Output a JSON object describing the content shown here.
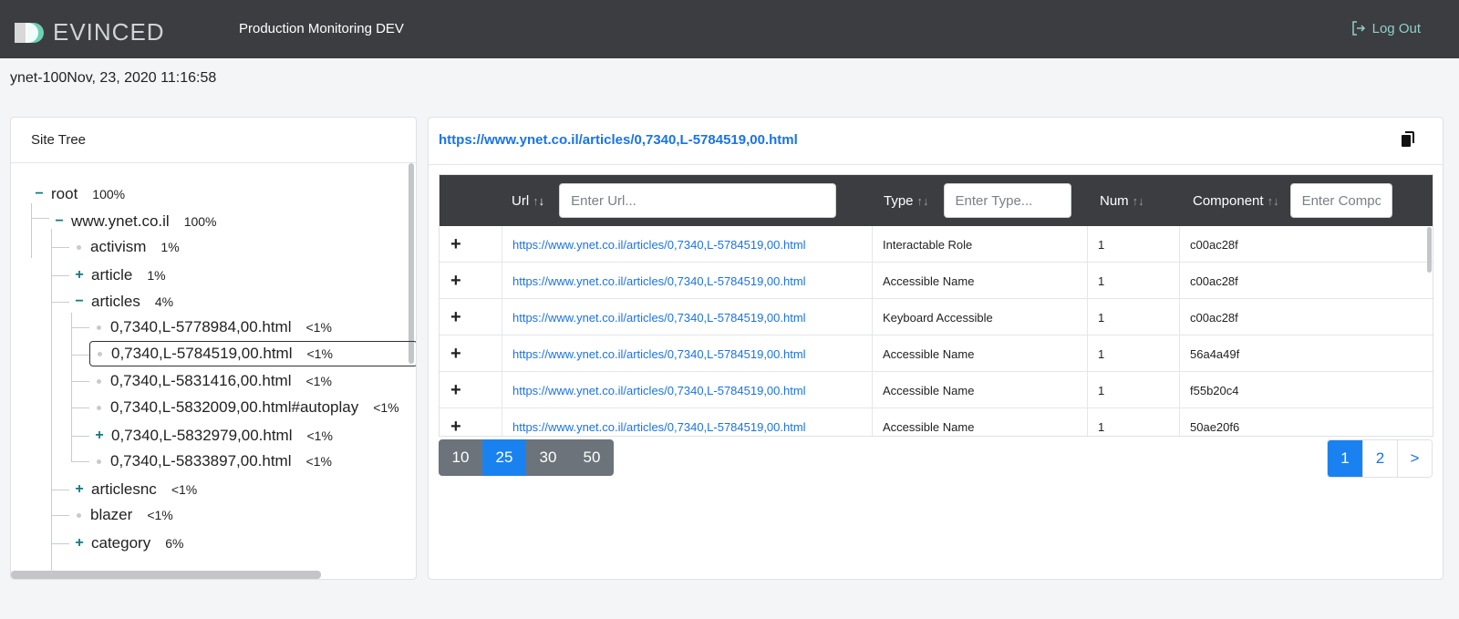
{
  "header": {
    "logo_text": "EVINCED",
    "app_title": "Production Monitoring DEV",
    "logout_label": "Log Out"
  },
  "run": {
    "label": "ynet-100Nov, 23, 2020 11:16:58"
  },
  "site_tree": {
    "title": "Site Tree",
    "nodes": [
      {
        "label": "root",
        "pct": "100%",
        "toggle": "−"
      },
      {
        "label": "www.ynet.co.il",
        "pct": "100%",
        "toggle": "−"
      },
      {
        "label": "activism",
        "pct": "1%",
        "toggle": ""
      },
      {
        "label": "article",
        "pct": "1%",
        "toggle": "+"
      },
      {
        "label": "articles",
        "pct": "4%",
        "toggle": "−"
      },
      {
        "label": "0,7340,L-5778984,00.html",
        "pct": "<1%",
        "toggle": ""
      },
      {
        "label": "0,7340,L-5784519,00.html",
        "pct": "<1%",
        "toggle": ""
      },
      {
        "label": "0,7340,L-5831416,00.html",
        "pct": "<1%",
        "toggle": ""
      },
      {
        "label": "0,7340,L-5832009,00.html#autoplay",
        "pct": "<1%",
        "toggle": ""
      },
      {
        "label": "0,7340,L-5832979,00.html",
        "pct": "<1%",
        "toggle": "+"
      },
      {
        "label": "0,7340,L-5833897,00.html",
        "pct": "<1%",
        "toggle": ""
      },
      {
        "label": "articlesnc",
        "pct": "<1%",
        "toggle": "+"
      },
      {
        "label": "blazer",
        "pct": "<1%",
        "toggle": ""
      },
      {
        "label": "category",
        "pct": "6%",
        "toggle": "+"
      }
    ]
  },
  "detail": {
    "url": "https://www.ynet.co.il/articles/0,7340,L-5784519,00.html",
    "columns": {
      "url": {
        "label": "Url",
        "placeholder": "Enter Url..."
      },
      "type": {
        "label": "Type",
        "placeholder": "Enter Type..."
      },
      "num": {
        "label": "Num"
      },
      "component": {
        "label": "Component",
        "placeholder": "Enter Component..."
      }
    },
    "rows": [
      {
        "expand": "+",
        "url": "https://www.ynet.co.il/articles/0,7340,L-5784519,00.html",
        "type": "Interactable Role",
        "num": "1",
        "component": "c00ac28f"
      },
      {
        "expand": "+",
        "url": "https://www.ynet.co.il/articles/0,7340,L-5784519,00.html",
        "type": "Accessible Name",
        "num": "1",
        "component": "c00ac28f"
      },
      {
        "expand": "+",
        "url": "https://www.ynet.co.il/articles/0,7340,L-5784519,00.html",
        "type": "Keyboard Accessible",
        "num": "1",
        "component": "c00ac28f"
      },
      {
        "expand": "+",
        "url": "https://www.ynet.co.il/articles/0,7340,L-5784519,00.html",
        "type": "Accessible Name",
        "num": "1",
        "component": "56a4a49f"
      },
      {
        "expand": "+",
        "url": "https://www.ynet.co.il/articles/0,7340,L-5784519,00.html",
        "type": "Accessible Name",
        "num": "1",
        "component": "f55b20c4"
      },
      {
        "expand": "+",
        "url": "https://www.ynet.co.il/articles/0,7340,L-5784519,00.html",
        "type": "Accessible Name",
        "num": "1",
        "component": "50ae20f6"
      }
    ],
    "page_sizes": [
      "10",
      "25",
      "30",
      "50"
    ],
    "active_page_size": "25",
    "pages": [
      "1",
      "2",
      ">"
    ],
    "active_page": "1"
  }
}
